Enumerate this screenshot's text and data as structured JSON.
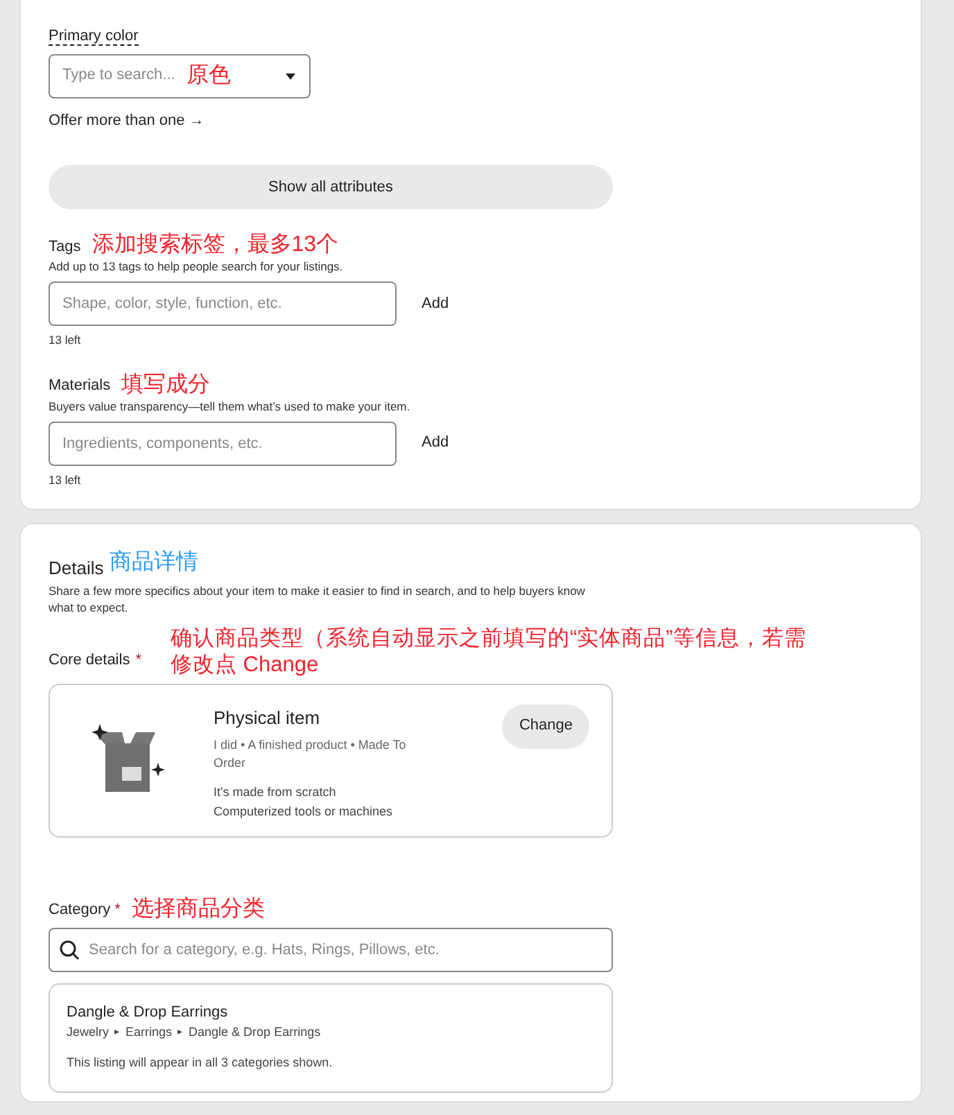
{
  "attributes_card": {
    "primary_color": {
      "label": "Primary color",
      "placeholder": "Type to search...",
      "annotation": {
        "text": "原色",
        "color": "#f5222d"
      },
      "link": "Offer more than one →"
    },
    "show_all_button": "Show all attributes",
    "fields": [
      {
        "label": "Tags",
        "annotation": {
          "text": "添加搜索标签，最多13个",
          "color": "#f5222d"
        },
        "help": "Add up to 13 tags to help people search for your listings.",
        "placeholder": "Shape, color, style, function, etc.",
        "button": "Add",
        "counter": "13 left"
      },
      {
        "label": "Materials",
        "annotation": {
          "text": "填写成分",
          "color": "#f5222d"
        },
        "help": "Buyers value transparency—tell them what’s used to make your item.",
        "placeholder": "Ingredients, components, etc.",
        "button": "Add",
        "counter": "13 left"
      }
    ]
  },
  "details_card": {
    "title": "Details",
    "annotation": {
      "text": "商品详情",
      "color": "#2b9af3"
    },
    "description": "Share a few more specifics about your item to make it easier to find in search, and to help buyers know what to expect.",
    "core_details": {
      "label": "Core details",
      "required_mark": "*",
      "annotation": {
        "text": "确认商品类型（系统自动显示之前填写的“实体商品”等信息，若需修改点 Change",
        "color": "#f5222d"
      },
      "item": {
        "title": "Physical item",
        "summary": "I did • A finished product • Made To Order",
        "lines": [
          "It's made from scratch",
          "Computerized tools or machines"
        ],
        "button": "Change"
      }
    },
    "category": {
      "label": "Category",
      "required_mark": "*",
      "annotation": {
        "text": "选择商品分类",
        "color": "#f5222d"
      },
      "placeholder": "Search for a category, e.g. Hats, Rings, Pillows, etc.",
      "result": {
        "title": "Dangle & Drop Earrings",
        "path": [
          "Jewelry",
          "Earrings",
          "Dangle & Drop Earrings"
        ],
        "path_separator": "▸",
        "note": "This listing will appear in all 3 categories shown."
      }
    }
  }
}
